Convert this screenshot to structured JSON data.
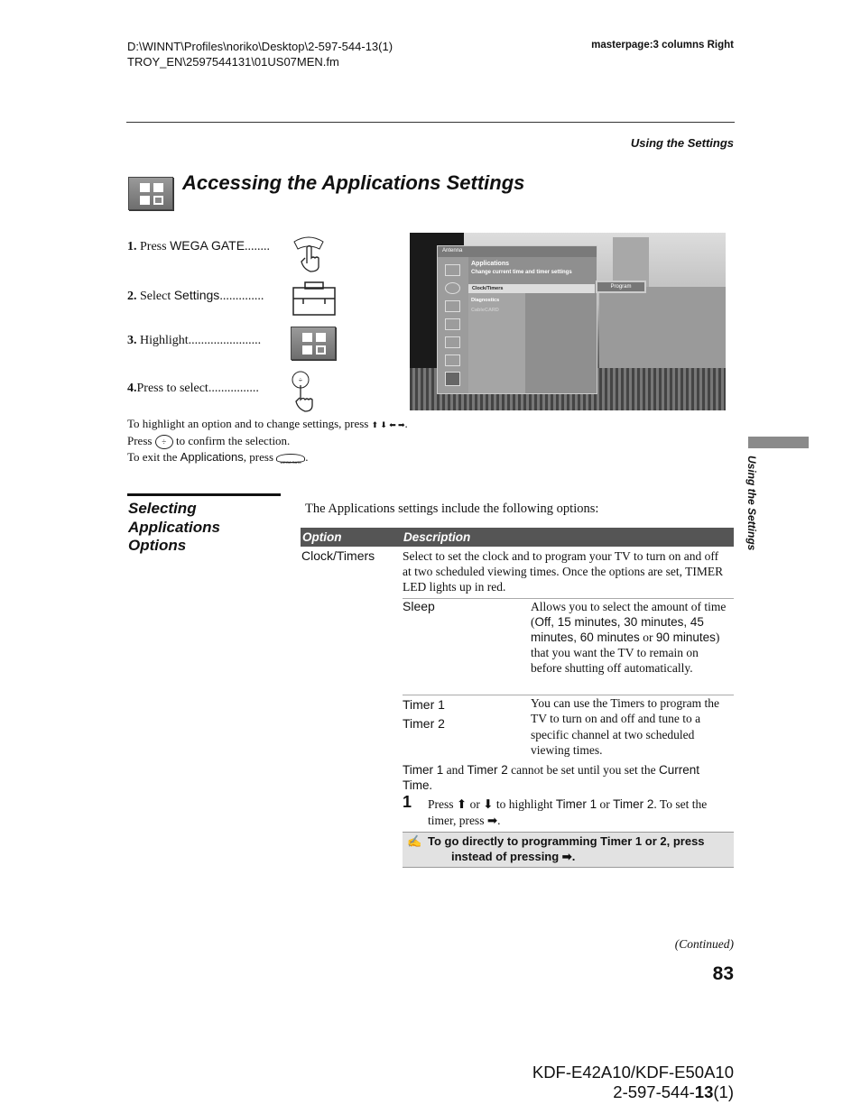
{
  "header": {
    "path_line1": "D:\\WINNT\\Profiles\\noriko\\Desktop\\2-597-544-13(1)",
    "path_line2": "TROY_EN\\2597544131\\01US07MEN.fm",
    "masterpage": "masterpage:3 columns Right"
  },
  "section_running_head": "Using the Settings",
  "title": "Accessing the Applications Settings",
  "steps": [
    {
      "num": "1.",
      "text": "Press ",
      "key": "WEGA GATE",
      "dots": "........"
    },
    {
      "num": "2.",
      "text": "Select ",
      "key": "Settings",
      "dots": ".............."
    },
    {
      "num": "3.",
      "text": "Highlight",
      "key": "",
      "dots": "......................."
    },
    {
      "num": "4.",
      "text": "Press to select",
      "key": "",
      "dots": "................"
    }
  ],
  "instructions": {
    "line1": "To highlight an option and to change settings, press",
    "arrows": "⬆ ⬇ ⬅ ➡",
    "line2a": "Press",
    "line2b": "to confirm the selection.",
    "line3a": "To exit the ",
    "line3key": "Applications",
    "line3b": ", press",
    "wega_label": "WEGA GATE"
  },
  "tv_menu": {
    "source": "Antenna",
    "heading": "Applications",
    "subheading": "Change current time and timer settings",
    "items": [
      "Clock/Timers",
      "Diagnostics",
      "CableCARD"
    ],
    "submenu_button": "Program"
  },
  "sub_heading": "Selecting Applications Options",
  "intro": "The Applications settings include the following options:",
  "table": {
    "headers": [
      "Option",
      "Description"
    ],
    "rows": [
      {
        "option": "Clock/Timers",
        "description": "Select to set the clock and to program your TV to turn on and off at two scheduled viewing times. Once the options are set, TIMER LED lights up in red."
      }
    ],
    "subrows": [
      {
        "option": "Sleep",
        "d1": "Allows you to select the amount of time (",
        "d2": "Off, 15 minutes, 30 minutes, 45 minutes, 60 minutes",
        "d3": " or ",
        "d4": "90 minutes",
        "d5": ") that you want the TV to remain on before shutting off automatically."
      },
      {
        "options": [
          "Timer 1",
          "Timer 2"
        ],
        "description": "You can use the Timers to program the TV to turn on and off and tune to a specific channel at two scheduled viewing times."
      }
    ],
    "caution": {
      "a": "Timer 1",
      "b": " and ",
      "c": "Timer 2",
      "d": " cannot be set until you set the ",
      "e": "Current Time",
      "f": "."
    },
    "step": {
      "num": "1",
      "a": "Press ⬆ or ⬇ to highlight ",
      "b": "Timer 1",
      "c": " or ",
      "d": "Timer 2",
      "e": ". To set the timer, press ➡."
    },
    "note": {
      "icon": "✍",
      "line1": "To go directly to programming Timer 1 or 2, press",
      "line2": "instead of pressing ➡."
    }
  },
  "continued": "(Continued)",
  "page_number": "83",
  "side_tab": "Using the Settings",
  "footer": {
    "model": "KDF-E42A10/KDF-E50A10",
    "code_a": "2-597-544-",
    "code_b": "13",
    "code_c": "(1)"
  },
  "colors": {
    "table_header": "#555555",
    "note_bg": "#e2e2e2",
    "side_tab": "#8a8a8a"
  }
}
